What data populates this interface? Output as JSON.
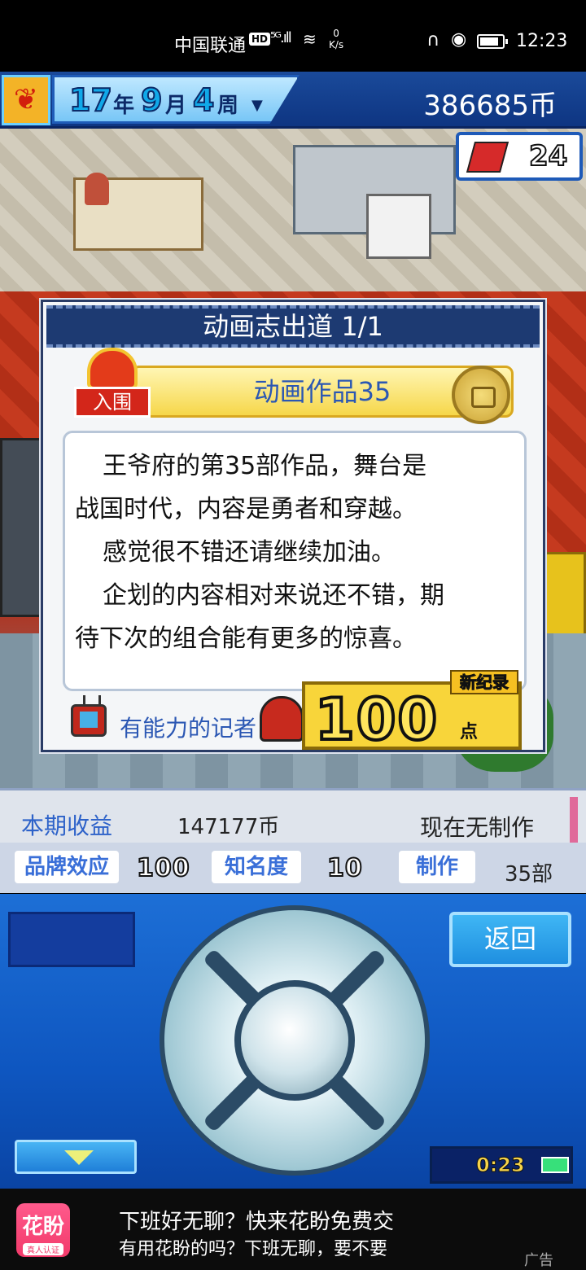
{
  "status_bar": {
    "carrier": "中国联通",
    "hd": "HD",
    "signal": "⁵ᴳ.ıll",
    "net_speed_value": "0",
    "net_speed_unit": "K/s",
    "time": "12:23"
  },
  "top_bar": {
    "year": "17",
    "year_unit": "年",
    "month": "9",
    "month_unit": "月",
    "week": "4",
    "week_unit": "周",
    "coins": "386685币"
  },
  "badge": {
    "count": "24"
  },
  "dialog": {
    "title": "动画志出道 1/1",
    "award_label": "入围",
    "award_name": "动画作品35",
    "review_lines": [
      "王爷府的第35部作品，舞台是",
      "战国时代，内容是勇者和穿越。",
      "感觉很不错还请继续加油。",
      "企划的内容相对来说还不错，期",
      "待下次的组合能有更多的惊喜。"
    ],
    "reporter": "有能力的记者",
    "score": "100",
    "score_unit": "点",
    "new_record": "新纪录"
  },
  "info": {
    "income_label": "本期收益",
    "income_value": "147177币",
    "production_status": "现在无制作",
    "brand_label": "品牌效应",
    "brand_value": "100",
    "fame_label": "知名度",
    "fame_value": "10",
    "works_label": "制作",
    "works_value": "35部"
  },
  "controller": {
    "back_label": "返回",
    "timer": "0:23"
  },
  "ad": {
    "logo_text": "花盼",
    "logo_sub": "真人认证",
    "line1": "下班好无聊？快来花盼免费交",
    "line2": "有用花盼的吗？下班无聊，要不要",
    "tag": "广告"
  },
  "colors": {
    "accent_blue": "#2b57b3",
    "panel_blue": "#1d3a72",
    "gold": "#f8d53a"
  }
}
